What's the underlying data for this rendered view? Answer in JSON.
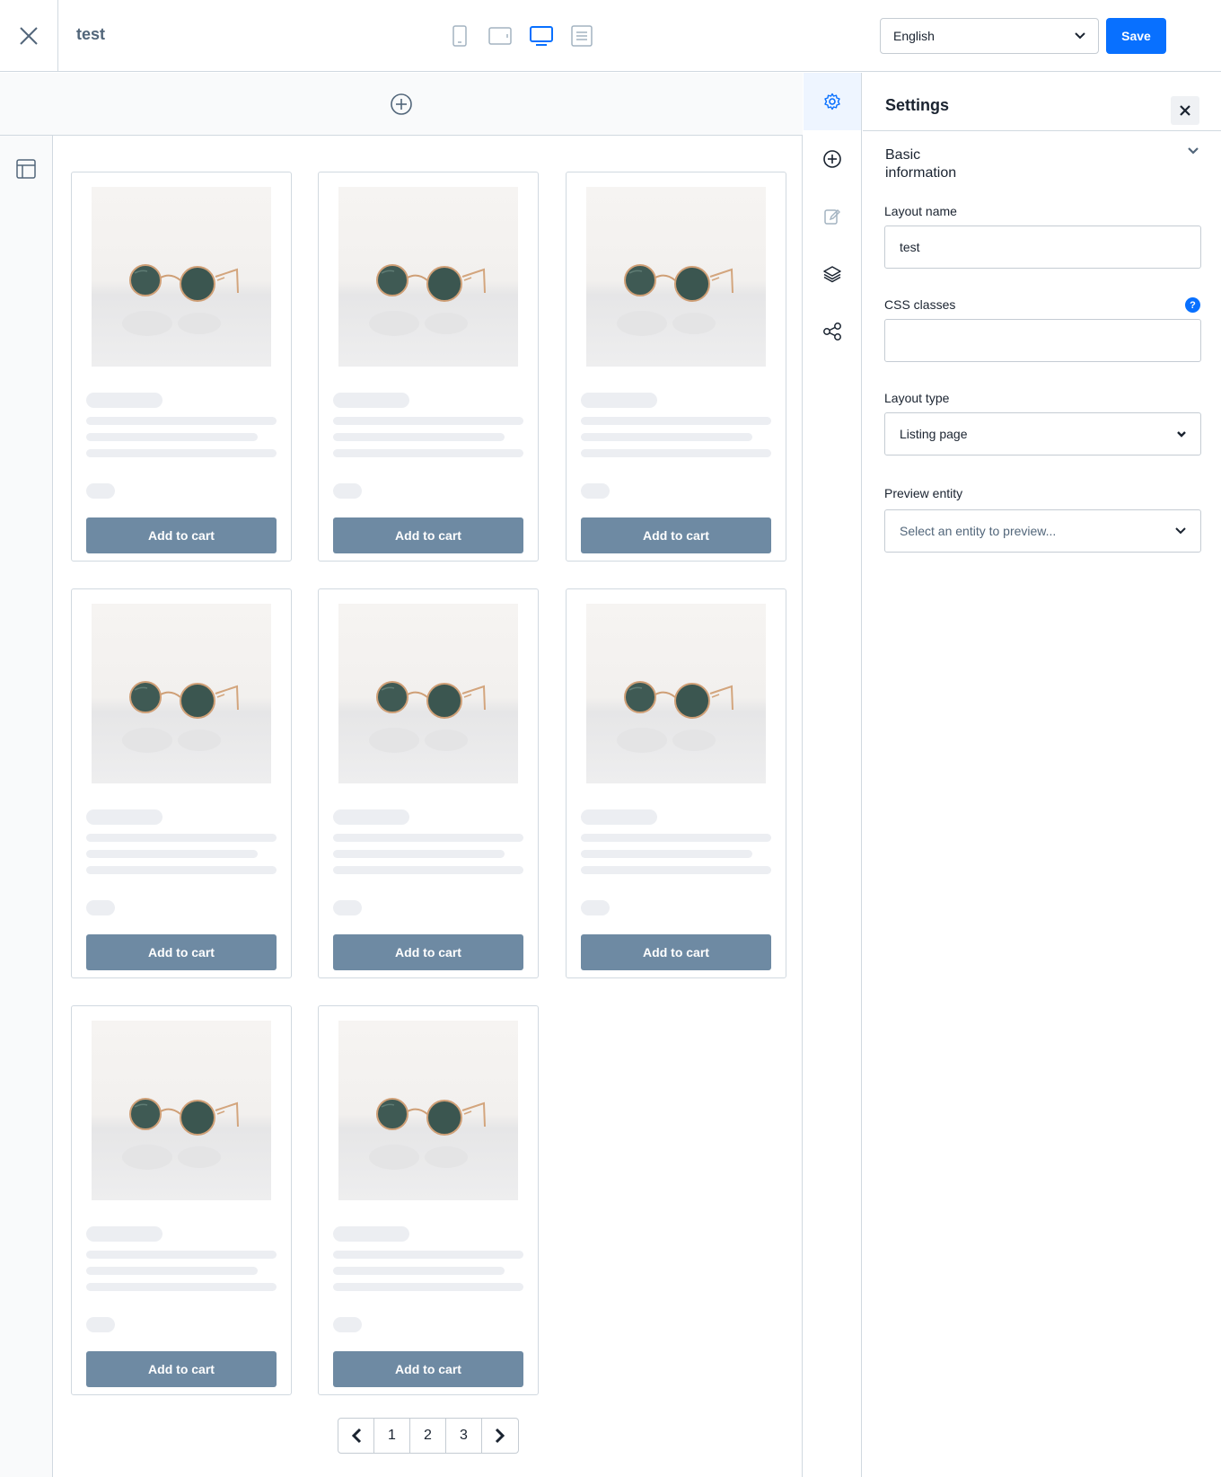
{
  "header": {
    "title": "test",
    "language": "English",
    "save_label": "Save",
    "accent_color": "#0870ff"
  },
  "device_modes": [
    {
      "icon": "mobile-icon",
      "active": false
    },
    {
      "icon": "tablet-icon",
      "active": false
    },
    {
      "icon": "desktop-icon",
      "active": true
    },
    {
      "icon": "form-icon",
      "active": false
    }
  ],
  "canvas": {
    "products": [
      {
        "button_label": "Add to cart"
      },
      {
        "button_label": "Add to cart"
      },
      {
        "button_label": "Add to cart"
      },
      {
        "button_label": "Add to cart"
      },
      {
        "button_label": "Add to cart"
      },
      {
        "button_label": "Add to cart"
      },
      {
        "button_label": "Add to cart"
      },
      {
        "button_label": "Add to cart"
      }
    ],
    "pagination": {
      "prev": "‹",
      "pages": [
        "1",
        "2",
        "3"
      ],
      "next": "›"
    }
  },
  "sidebar_tabs": [
    {
      "icon": "gear-icon",
      "active": true
    },
    {
      "icon": "plus-circle-icon",
      "active": false
    },
    {
      "icon": "edit-icon",
      "active": false
    },
    {
      "icon": "layers-icon",
      "active": false
    },
    {
      "icon": "share-icon",
      "active": false
    }
  ],
  "settings": {
    "title": "Settings",
    "section_title": "Basic information",
    "layout_name_label": "Layout name",
    "layout_name_value": "test",
    "css_classes_label": "CSS classes",
    "css_classes_value": "",
    "help_glyph": "?",
    "layout_type_label": "Layout type",
    "layout_type_value": "Listing page",
    "preview_entity_label": "Preview entity",
    "preview_entity_placeholder": "Select an entity to preview..."
  }
}
